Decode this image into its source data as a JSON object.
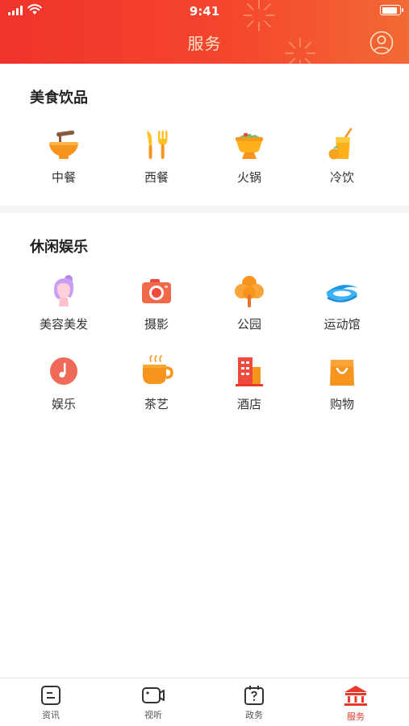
{
  "status_bar": {
    "time": "9:41"
  },
  "header": {
    "title": "服务"
  },
  "sections": [
    {
      "title": "美食饮品",
      "items": [
        {
          "label": "中餐",
          "icon": "noodle-bowl-icon"
        },
        {
          "label": "西餐",
          "icon": "fork-knife-icon"
        },
        {
          "label": "火锅",
          "icon": "hotpot-icon"
        },
        {
          "label": "冷饮",
          "icon": "cold-drink-icon"
        }
      ]
    },
    {
      "title": "休闲娱乐",
      "items": [
        {
          "label": "美容美发",
          "icon": "hair-salon-icon"
        },
        {
          "label": "摄影",
          "icon": "camera-icon"
        },
        {
          "label": "公园",
          "icon": "tree-icon"
        },
        {
          "label": "运动馆",
          "icon": "stadium-icon"
        },
        {
          "label": "娱乐",
          "icon": "music-note-icon"
        },
        {
          "label": "茶艺",
          "icon": "teacup-icon"
        },
        {
          "label": "酒店",
          "icon": "hotel-building-icon"
        },
        {
          "label": "购物",
          "icon": "shopping-bag-icon"
        }
      ]
    }
  ],
  "tabbar": {
    "items": [
      {
        "label": "资讯",
        "icon": "news-icon",
        "active": false
      },
      {
        "label": "视听",
        "icon": "video-icon",
        "active": false
      },
      {
        "label": "政务",
        "icon": "government-affairs-icon",
        "active": false
      },
      {
        "label": "服务",
        "icon": "service-hall-icon",
        "active": true
      }
    ]
  },
  "colors": {
    "brand": "#e8392b",
    "title_text": "#fde3c8",
    "icon_orange": "#f7941d",
    "icon_red": "#f04a3c"
  }
}
